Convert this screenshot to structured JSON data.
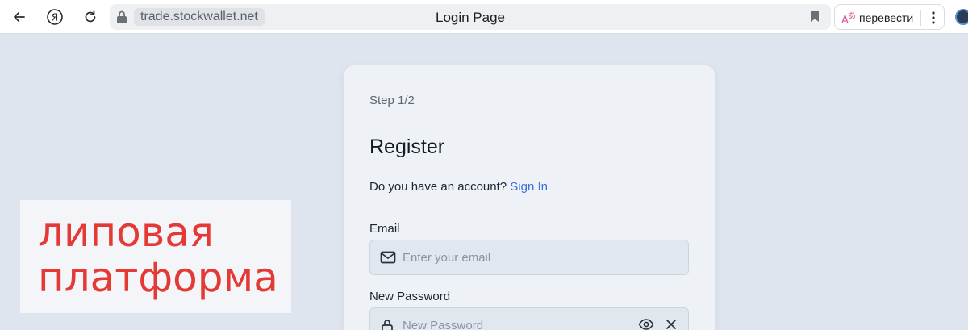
{
  "browser": {
    "url": "trade.stockwallet.net",
    "tab_title": "Login Page",
    "translate_label": "перевести"
  },
  "overlay": {
    "text": "липовая\nплатформа",
    "color": "#e53935"
  },
  "form": {
    "step": "Step 1/2",
    "heading": "Register",
    "account_prompt": "Do you have an account?",
    "sign_in": "Sign In",
    "email_label": "Email",
    "email_placeholder": "Enter your email",
    "password_label": "New Password",
    "password_placeholder": "New Password",
    "link_color": "#3a6fd8"
  }
}
